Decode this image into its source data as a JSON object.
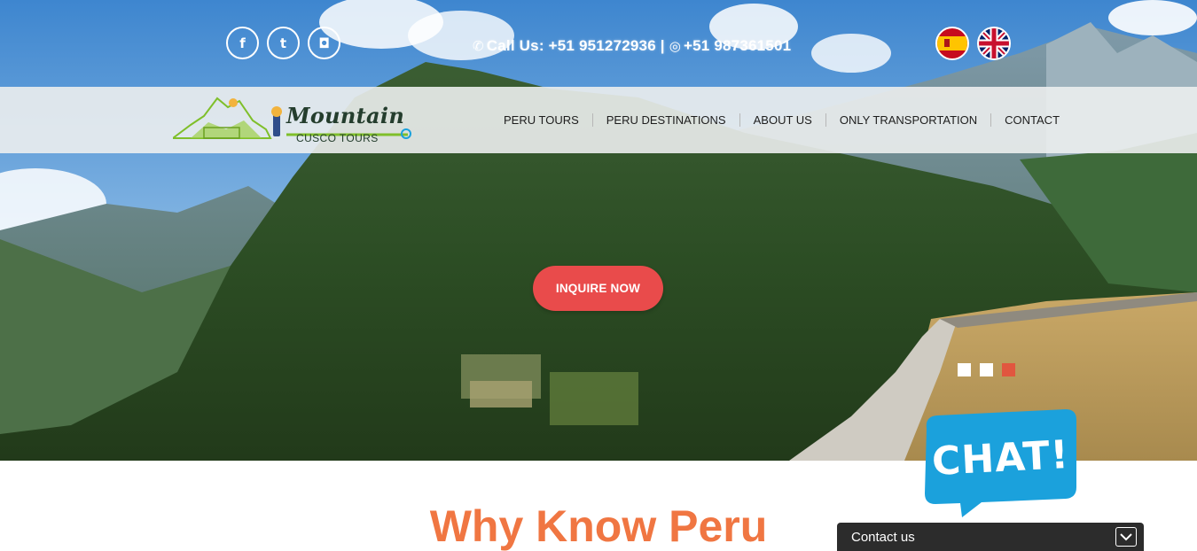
{
  "topbar": {
    "social_icons": [
      "facebook-icon",
      "twitter-icon",
      "instagram-icon"
    ],
    "social_glyphs": [
      "f",
      "t",
      "◘"
    ],
    "phone_label": "Call Us: +51 951272936",
    "separator": "|",
    "whatsapp": "+51 987361501",
    "languages": [
      "Spanish",
      "English"
    ]
  },
  "header": {
    "logo_title": "Mountain",
    "logo_subtitle": "CUSCO TOURS",
    "nav": [
      {
        "label": "PERU TOURS"
      },
      {
        "label": "PERU DESTINATIONS"
      },
      {
        "label": "ABOUT US"
      },
      {
        "label": "ONLY TRANSPORTATION"
      },
      {
        "label": "CONTACT"
      }
    ]
  },
  "hero": {
    "cta_label": "INQUIRE NOW",
    "slides_total": 3,
    "active_slide": 3
  },
  "chat": {
    "bubble_text": "CHAT!",
    "contact_label": "Contact us"
  },
  "section": {
    "title": "Why Know Peru"
  },
  "colors": {
    "accent": "#e94b4b",
    "title_orange": "#f07642",
    "chat_blue": "#1ba1dc",
    "contact_bar": "#2c2c2c",
    "logo_green": "#7fbf2a"
  }
}
